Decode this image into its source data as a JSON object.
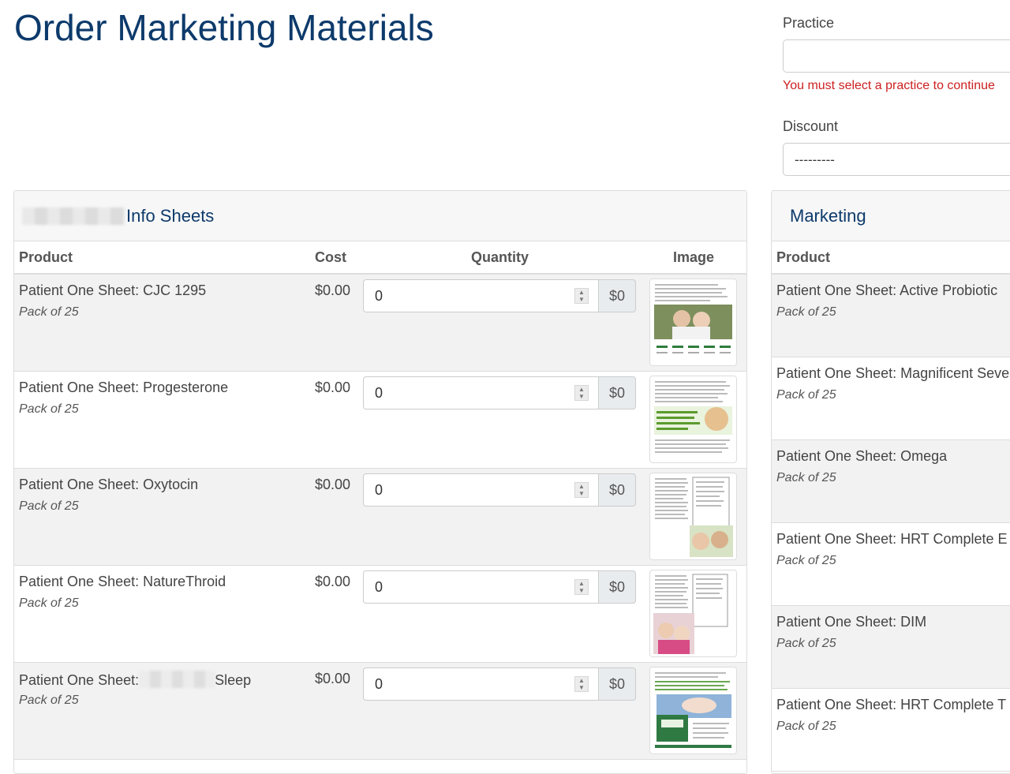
{
  "page": {
    "title": "Order Marketing Materials"
  },
  "form": {
    "practice_label": "Practice",
    "practice_value": "",
    "practice_error": "You must select a practice to continue",
    "discount_label": "Discount",
    "discount_value": "---------"
  },
  "left_panel": {
    "title": "Info Sheets",
    "headers": {
      "product": "Product",
      "cost": "Cost",
      "quantity": "Quantity",
      "image": "Image"
    },
    "rows": [
      {
        "name": "Patient One Sheet: CJC 1295",
        "pack": "Pack of 25",
        "cost": "$0.00",
        "quantity": "0",
        "total": "$0"
      },
      {
        "name": "Patient One Sheet: Progesterone",
        "pack": "Pack of 25",
        "cost": "$0.00",
        "quantity": "0",
        "total": "$0"
      },
      {
        "name": "Patient One Sheet: Oxytocin",
        "pack": "Pack of 25",
        "cost": "$0.00",
        "quantity": "0",
        "total": "$0"
      },
      {
        "name": "Patient One Sheet: NatureThroid",
        "pack": "Pack of 25",
        "cost": "$0.00",
        "quantity": "0",
        "total": "$0"
      },
      {
        "name_prefix": "Patient One Sheet:",
        "name_suffix": "Sleep",
        "pack": "Pack of 25",
        "cost": "$0.00",
        "quantity": "0",
        "total": "$0"
      }
    ]
  },
  "right_panel": {
    "title": "Marketing",
    "headers": {
      "product": "Product"
    },
    "rows": [
      {
        "name": "Patient One Sheet: Active Probiotic",
        "pack": "Pack of 25"
      },
      {
        "name": "Patient One Sheet: Magnificent Seve",
        "pack": "Pack of 25"
      },
      {
        "name": "Patient One Sheet: Omega",
        "pack": "Pack of 25"
      },
      {
        "name": "Patient One Sheet: HRT Complete E",
        "pack": "Pack of 25"
      },
      {
        "name": "Patient One Sheet: DIM",
        "pack": "Pack of 25"
      },
      {
        "name": "Patient One Sheet: HRT Complete T",
        "pack": "Pack of 25"
      }
    ]
  },
  "icons": {
    "spinner": "number-spinner-icon"
  },
  "colors": {
    "title": "#0d3a6b",
    "error": "#cc1f1f",
    "row_alt": "#f2f2f2"
  }
}
